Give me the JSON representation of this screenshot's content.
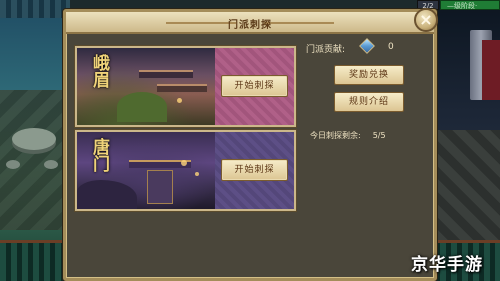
{
  "hud": {
    "level": "2/2",
    "bar_text": "—级阶段·"
  },
  "panel": {
    "title": "门派刺探",
    "close_label": "×"
  },
  "sects": [
    {
      "name": "峨眉",
      "button": "开始刺探"
    },
    {
      "name": "唐门",
      "button": "开始刺探"
    }
  ],
  "info": {
    "contribution_label": "门派贡献:",
    "contribution_value": "0",
    "reward_button": "奖励兑换",
    "rules_button": "规则介绍",
    "attempts_label": "今日刺探剩余:",
    "attempts_value": "5/5"
  },
  "watermark": "京华手游",
  "colors": {
    "panel_bg": "#4a463a",
    "gold_border": "#a48d5a",
    "button_text": "#5b3514",
    "sect_name": "#f0d37a"
  }
}
